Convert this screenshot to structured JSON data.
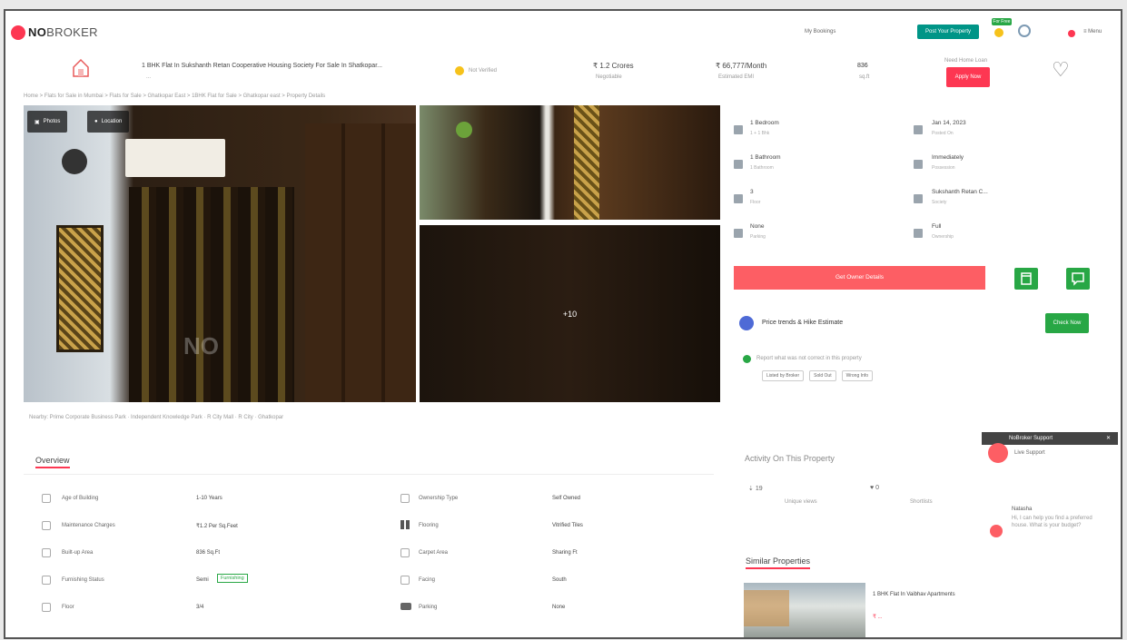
{
  "nav": {
    "logo_bold": "NO",
    "logo_light": "BROKER",
    "my_bookings": "My Bookings",
    "link2": "",
    "link3": "",
    "post_property": "Post Your Property",
    "free_badge": "For Free",
    "menu": "Menu"
  },
  "header": {
    "title": "1 BHK Flat In Sukshanth Retan Cooperative Housing Society For Sale In Shatkopar...",
    "address": "...",
    "verified": "Not Verified",
    "price": "₹ 1.2 Crores",
    "price_sub": "Negotiable",
    "emi": "₹ 66,777/Month",
    "emi_sub": "Estimated EMI",
    "area": "836",
    "area_sub": "sq.ft",
    "loan_text": "Need Home Loan",
    "loan_btn": "Apply Now"
  },
  "breadcrumb": "Home > Flats for Sale in Mumbai > Flats for Sale > Ghatkopar East > 1BHK Flat for Sale > Ghatkopar east > Property Details",
  "gallery": {
    "photos_btn": "Photos",
    "location_btn": "Location",
    "more_count": "+10",
    "wall_text": "NO"
  },
  "nearby": "Nearby: Prime Corporate Business Park · Independent Knowledge Park · R City Mall · R City · Ghatkopar",
  "details": [
    {
      "label": "1 Bedroom",
      "sub": "1 + 1 Bhk"
    },
    {
      "label": "Jan 14, 2023",
      "sub": "Posted On"
    },
    {
      "label": "1 Bathroom",
      "sub": "1 Bathroom"
    },
    {
      "label": "Immediately",
      "sub": "Possession"
    },
    {
      "label": "3",
      "sub": "Floor"
    },
    {
      "label": "Sukshanth Retan C...",
      "sub": "Society"
    },
    {
      "label": "None",
      "sub": "Parking"
    },
    {
      "label": "Full",
      "sub": "Ownership"
    }
  ],
  "actions": {
    "get_owner": "Get Owner Details",
    "finance_title": "Price trends & Hike Estimate",
    "check_now": "Check Now",
    "report_text": "Report what was not correct in this property",
    "chips": [
      "Listed by Broker",
      "Sold Out",
      "Wrong Info"
    ]
  },
  "overview": {
    "title": "Overview",
    "rows": [
      {
        "l_label": "Age of Building",
        "l_val": "1-10 Years",
        "r_label": "Ownership Type",
        "r_val": "Self Owned"
      },
      {
        "l_label": "Maintenance Charges",
        "l_val": "₹1.2 Per Sq.Feet",
        "r_label": "Flooring",
        "r_val": "Vitrified Tiles"
      },
      {
        "l_label": "Built-up Area",
        "l_val": "836 Sq.Ft",
        "r_label": "Carpet Area",
        "r_val": "Sharing Ft"
      },
      {
        "l_label": "Furnishing Status",
        "l_val": "Semi",
        "l_tag": "Furnishing",
        "r_label": "Facing",
        "r_val": "South"
      },
      {
        "l_label": "Floor",
        "l_val": "3/4",
        "r_label": "Parking",
        "r_val": "None"
      }
    ]
  },
  "activity": {
    "title": "Activity On This Property",
    "views": "19",
    "views_sub": "Unique views",
    "shortlists": "0",
    "shortlists_sub": "Shortlists"
  },
  "similar": {
    "title": "Similar Properties",
    "item": "1 BHK Flat In Vaibhav Apartments",
    "item_price": "₹ ..."
  },
  "chat": {
    "header": "NoBroker Support",
    "agent": "Live Support",
    "name": "Natasha",
    "message": "Hi, I can help you find a preferred house. What is your budget?"
  },
  "colors": {
    "brand_red": "#fd3752",
    "green": "#28a745",
    "teal": "#009587",
    "salmon": "#fd5e64"
  }
}
